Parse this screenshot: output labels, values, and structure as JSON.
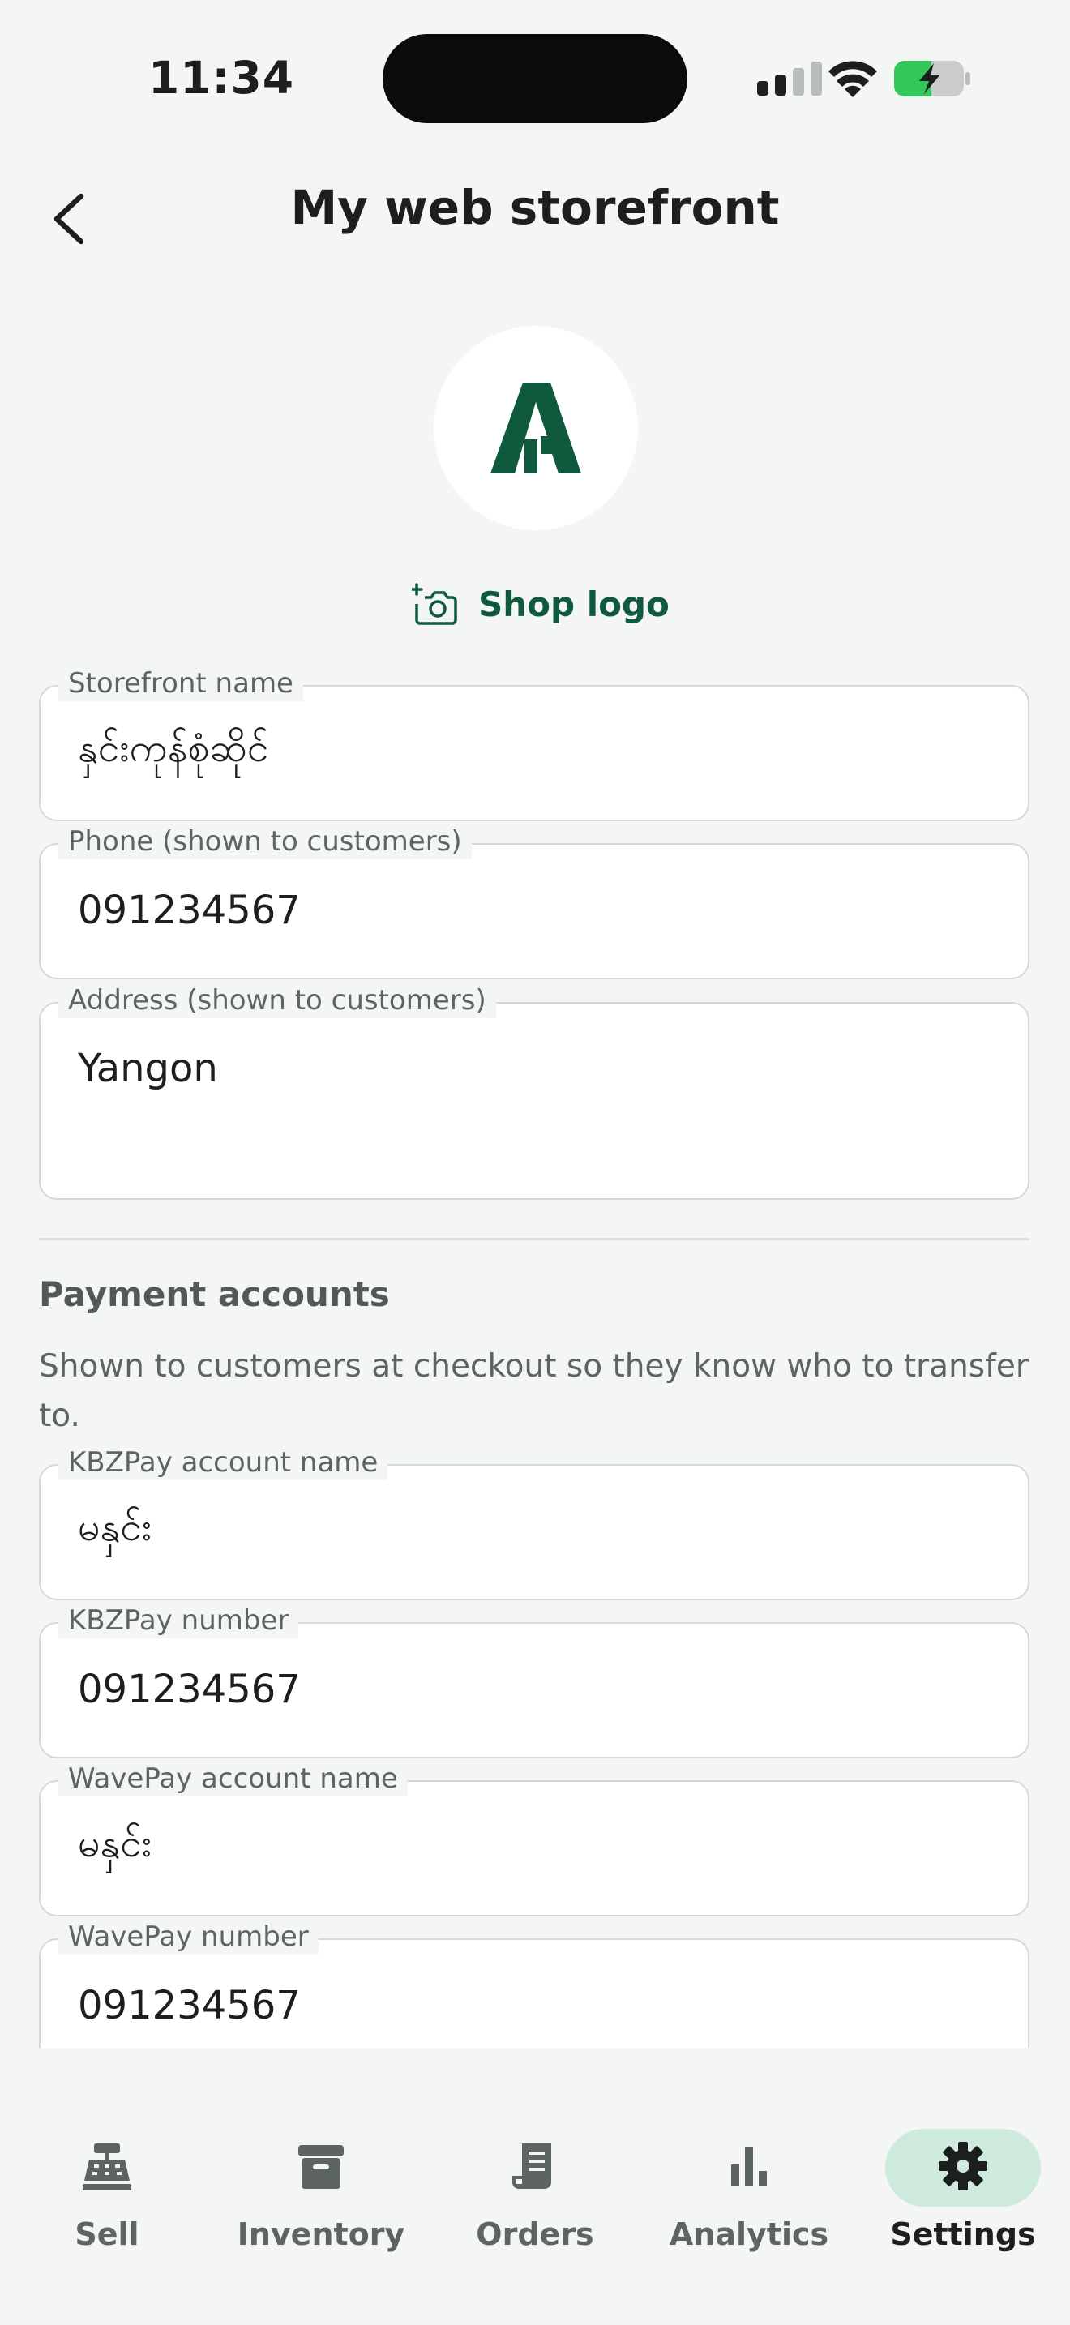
{
  "status_bar": {
    "time": "11:34"
  },
  "header": {
    "title": "My web storefront"
  },
  "logo": {
    "letter": "A",
    "action_label": "Shop logo"
  },
  "fields": {
    "storefront_name": {
      "label": "Storefront name",
      "value": "နှင်းကုန်စုံဆိုင်"
    },
    "phone": {
      "label": "Phone (shown to customers)",
      "value": "091234567"
    },
    "address": {
      "label": "Address (shown to customers)",
      "value": "Yangon"
    }
  },
  "payment": {
    "title": "Payment accounts",
    "description": "Shown to customers at checkout so they know who to transfer to.",
    "kbzpay_name": {
      "label": "KBZPay account name",
      "value": "မနှင်း"
    },
    "kbzpay_number": {
      "label": "KBZPay number",
      "value": "091234567"
    },
    "wavepay_name": {
      "label": "WavePay account name",
      "value": "မနှင်း"
    },
    "wavepay_number": {
      "label": "WavePay number",
      "value": "091234567"
    }
  },
  "nav": {
    "items": [
      {
        "label": "Sell",
        "icon": "cash-register-icon"
      },
      {
        "label": "Inventory",
        "icon": "archive-box-icon"
      },
      {
        "label": "Orders",
        "icon": "receipt-icon"
      },
      {
        "label": "Analytics",
        "icon": "bar-chart-icon"
      },
      {
        "label": "Settings",
        "icon": "gear-icon"
      }
    ],
    "active": "Settings"
  },
  "colors": {
    "brand_green": "#0f5a3c",
    "active_pill": "#cdeadd",
    "background": "#f4f6f5",
    "battery_green": "#34c759"
  }
}
